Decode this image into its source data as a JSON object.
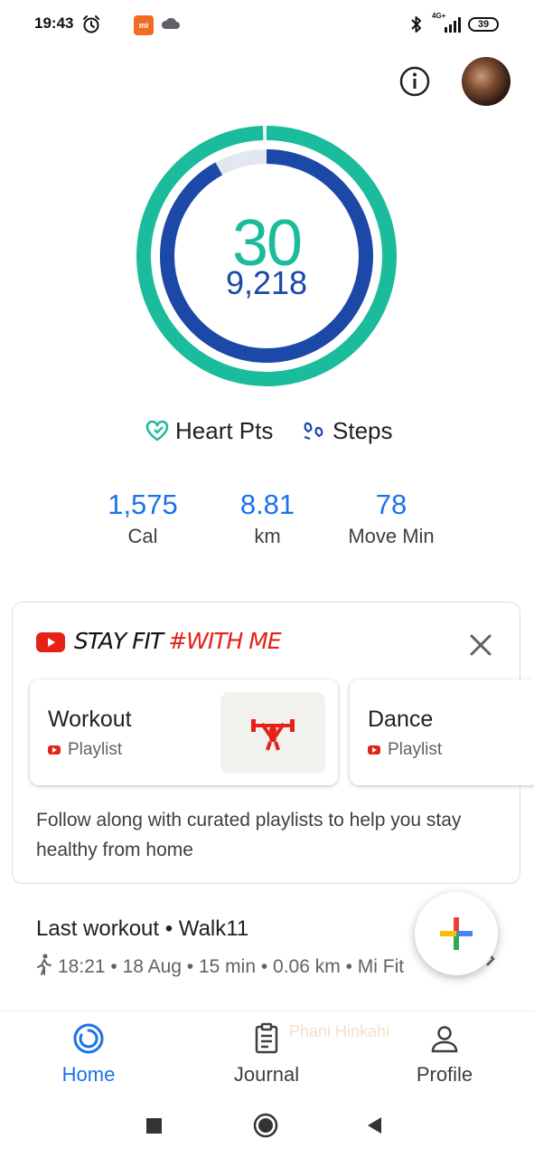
{
  "status_bar": {
    "time": "19:43",
    "mi_badge": "mi",
    "network": "4G+",
    "battery": "39"
  },
  "summary": {
    "heart_points": "30",
    "steps": "9,218",
    "ring_colors": {
      "heart": "#1bbc9b",
      "steps": "#1c48a8",
      "track": "#e3e8f0"
    },
    "heart_progress": 0.995,
    "steps_progress": 0.92
  },
  "legend": {
    "heart_label": "Heart Pts",
    "steps_label": "Steps"
  },
  "stats": [
    {
      "value": "1,575",
      "label": "Cal"
    },
    {
      "value": "8.81",
      "label": "km"
    },
    {
      "value": "78",
      "label": "Move Min"
    }
  ],
  "promo": {
    "title_part1": "STAY FIT",
    "title_part2": "#WITH ME",
    "playlists": [
      {
        "title": "Workout",
        "subtitle": "Playlist"
      },
      {
        "title": "Dance",
        "subtitle": "Playlist"
      }
    ],
    "description": "Follow along with curated playlists to help you stay healthy from home"
  },
  "last_workout": {
    "title": "Last workout • Walk11",
    "meta": "18:21 • 18 Aug • 15 min • 0.06 km • Mi Fit"
  },
  "bottom_nav": {
    "home": "Home",
    "journal": "Journal",
    "profile": "Profile",
    "ghost_text": "Phani Hinkahi"
  }
}
